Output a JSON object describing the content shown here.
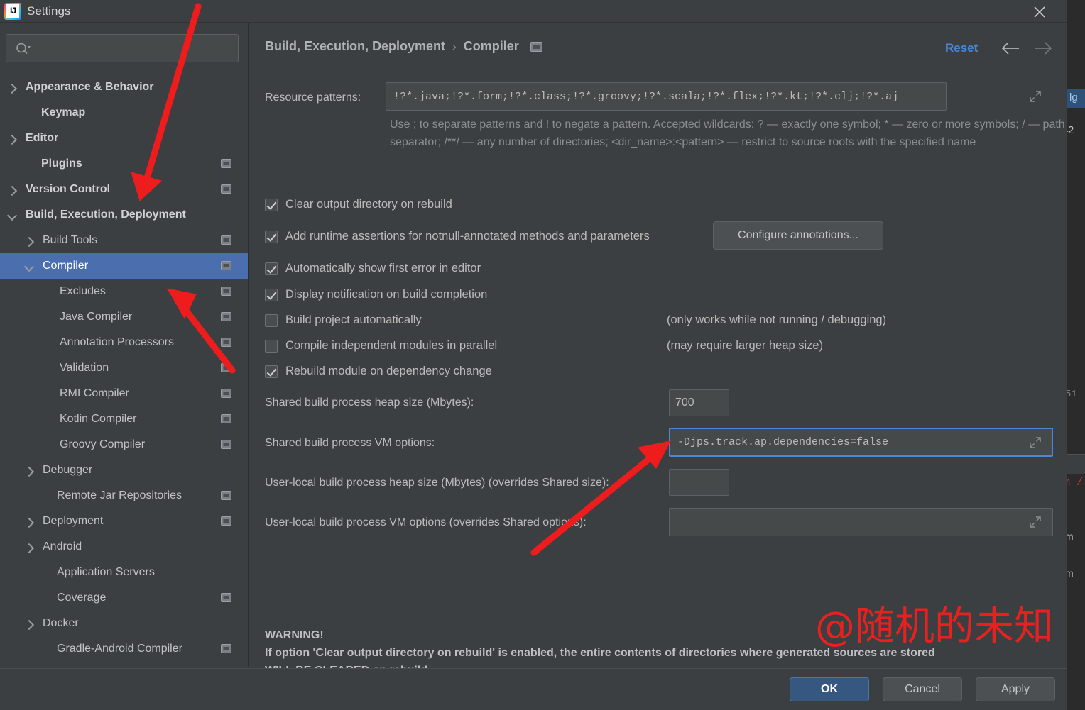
{
  "window": {
    "title": "Settings",
    "app_icon": "intellij-idea-icon",
    "close_icon": "close-icon"
  },
  "sidebar": {
    "search": {
      "placeholder": "",
      "value": "",
      "icon": "search-icon"
    },
    "items": [
      {
        "label": "Appearance & Behavior",
        "indent": 14,
        "arrow": "right",
        "bold": true,
        "mod": false,
        "selected": false
      },
      {
        "label": "Keymap",
        "indent": 36,
        "arrow": "none",
        "bold": true,
        "mod": false,
        "selected": false
      },
      {
        "label": "Editor",
        "indent": 14,
        "arrow": "right",
        "bold": true,
        "mod": false,
        "selected": false
      },
      {
        "label": "Plugins",
        "indent": 36,
        "arrow": "none",
        "bold": true,
        "mod": true,
        "selected": false
      },
      {
        "label": "Version Control",
        "indent": 14,
        "arrow": "right",
        "bold": true,
        "mod": true,
        "selected": false
      },
      {
        "label": "Build, Execution, Deployment",
        "indent": 14,
        "arrow": "down",
        "bold": true,
        "mod": false,
        "selected": false
      },
      {
        "label": "Build Tools",
        "indent": 38,
        "arrow": "right",
        "bold": false,
        "mod": true,
        "selected": false
      },
      {
        "label": "Compiler",
        "indent": 38,
        "arrow": "down",
        "bold": false,
        "mod": true,
        "selected": true
      },
      {
        "label": "Excludes",
        "indent": 62,
        "arrow": "none",
        "bold": false,
        "mod": true,
        "selected": false
      },
      {
        "label": "Java Compiler",
        "indent": 62,
        "arrow": "none",
        "bold": false,
        "mod": true,
        "selected": false
      },
      {
        "label": "Annotation Processors",
        "indent": 62,
        "arrow": "none",
        "bold": false,
        "mod": true,
        "selected": false
      },
      {
        "label": "Validation",
        "indent": 62,
        "arrow": "none",
        "bold": false,
        "mod": true,
        "selected": false
      },
      {
        "label": "RMI Compiler",
        "indent": 62,
        "arrow": "none",
        "bold": false,
        "mod": true,
        "selected": false
      },
      {
        "label": "Kotlin Compiler",
        "indent": 62,
        "arrow": "none",
        "bold": false,
        "mod": true,
        "selected": false
      },
      {
        "label": "Groovy Compiler",
        "indent": 62,
        "arrow": "none",
        "bold": false,
        "mod": true,
        "selected": false
      },
      {
        "label": "Debugger",
        "indent": 38,
        "arrow": "right",
        "bold": false,
        "mod": false,
        "selected": false
      },
      {
        "label": "Remote Jar Repositories",
        "indent": 58,
        "arrow": "none",
        "bold": false,
        "mod": true,
        "selected": false
      },
      {
        "label": "Deployment",
        "indent": 38,
        "arrow": "right",
        "bold": false,
        "mod": true,
        "selected": false
      },
      {
        "label": "Android",
        "indent": 38,
        "arrow": "right",
        "bold": false,
        "mod": false,
        "selected": false
      },
      {
        "label": "Application Servers",
        "indent": 58,
        "arrow": "none",
        "bold": false,
        "mod": false,
        "selected": false
      },
      {
        "label": "Coverage",
        "indent": 58,
        "arrow": "none",
        "bold": false,
        "mod": true,
        "selected": false
      },
      {
        "label": "Docker",
        "indent": 38,
        "arrow": "right",
        "bold": false,
        "mod": false,
        "selected": false
      },
      {
        "label": "Gradle-Android Compiler",
        "indent": 58,
        "arrow": "none",
        "bold": false,
        "mod": true,
        "selected": false
      }
    ],
    "help_label": "?"
  },
  "header": {
    "breadcrumb_root": "Build, Execution, Deployment",
    "breadcrumb_sep": "›",
    "breadcrumb_leaf": "Compiler",
    "breadcrumb_icon": "project-settings-icon",
    "reset_label": "Reset",
    "back_icon": "arrow-left-icon",
    "forward_icon": "arrow-right-icon"
  },
  "form": {
    "resource_patterns": {
      "label": "Resource patterns:",
      "value": "!?*.java;!?*.form;!?*.class;!?*.groovy;!?*.scala;!?*.flex;!?*.kt;!?*.clj;!?*.aj",
      "expand_icon": "expand-icon"
    },
    "hint_line1_a": "Use ",
    "hint_line1_b": "; ",
    "hint": "Use ; to separate patterns and ! to negate a pattern. Accepted wildcards: ? — exactly one symbol; * — zero or more symbols; / — path separator; /**/ — any number of directories; <dir_name>:<pattern> — restrict to source roots with the specified name",
    "checkboxes": [
      {
        "label": "Clear output directory on rebuild",
        "checked": true
      },
      {
        "label": "Add runtime assertions for notnull-annotated methods and parameters",
        "checked": true
      },
      {
        "label": "Automatically show first error in editor",
        "checked": true
      },
      {
        "label": "Display notification on build completion",
        "checked": true
      },
      {
        "label": "Build project automatically",
        "checked": false
      },
      {
        "label": "Compile independent modules in parallel",
        "checked": false
      },
      {
        "label": "Rebuild module on dependency change",
        "checked": true
      }
    ],
    "configure_annotations_label": "Configure annotations...",
    "note_build_auto": "(only works while not running / debugging)",
    "note_parallel": "(may require larger heap size)",
    "shared_heap": {
      "label": "Shared build process heap size (Mbytes):",
      "value": "700"
    },
    "shared_vm": {
      "label": "Shared build process VM options:",
      "value": "-Djps.track.ap.dependencies=false",
      "expand_icon": "expand-icon",
      "focused": true
    },
    "local_heap": {
      "label": "User-local build process heap size (Mbytes) (overrides Shared size):",
      "value": ""
    },
    "local_vm": {
      "label": "User-local build process VM options (overrides Shared options):",
      "value": "",
      "expand_icon": "expand-icon"
    },
    "warning_title": "WARNING!",
    "warning_line1": "If option 'Clear output directory on rebuild' is enabled, the entire contents of directories where generated sources are stored",
    "warning_line2": "WILL BE CLEARED on rebuild."
  },
  "footer": {
    "ok_label": "OK",
    "cancel_label": "Cancel",
    "apply_label": "Apply"
  },
  "annotations": {
    "watermark": "@随机的未知",
    "watermark_color": "#e8201f",
    "arrow_color": "#ee1c1c"
  },
  "background_ide": {
    "tab_label": "lg",
    "warning_count": "2",
    "line_number": "51",
    "red_text": "m /",
    "text1": "m",
    "text2": "m"
  }
}
